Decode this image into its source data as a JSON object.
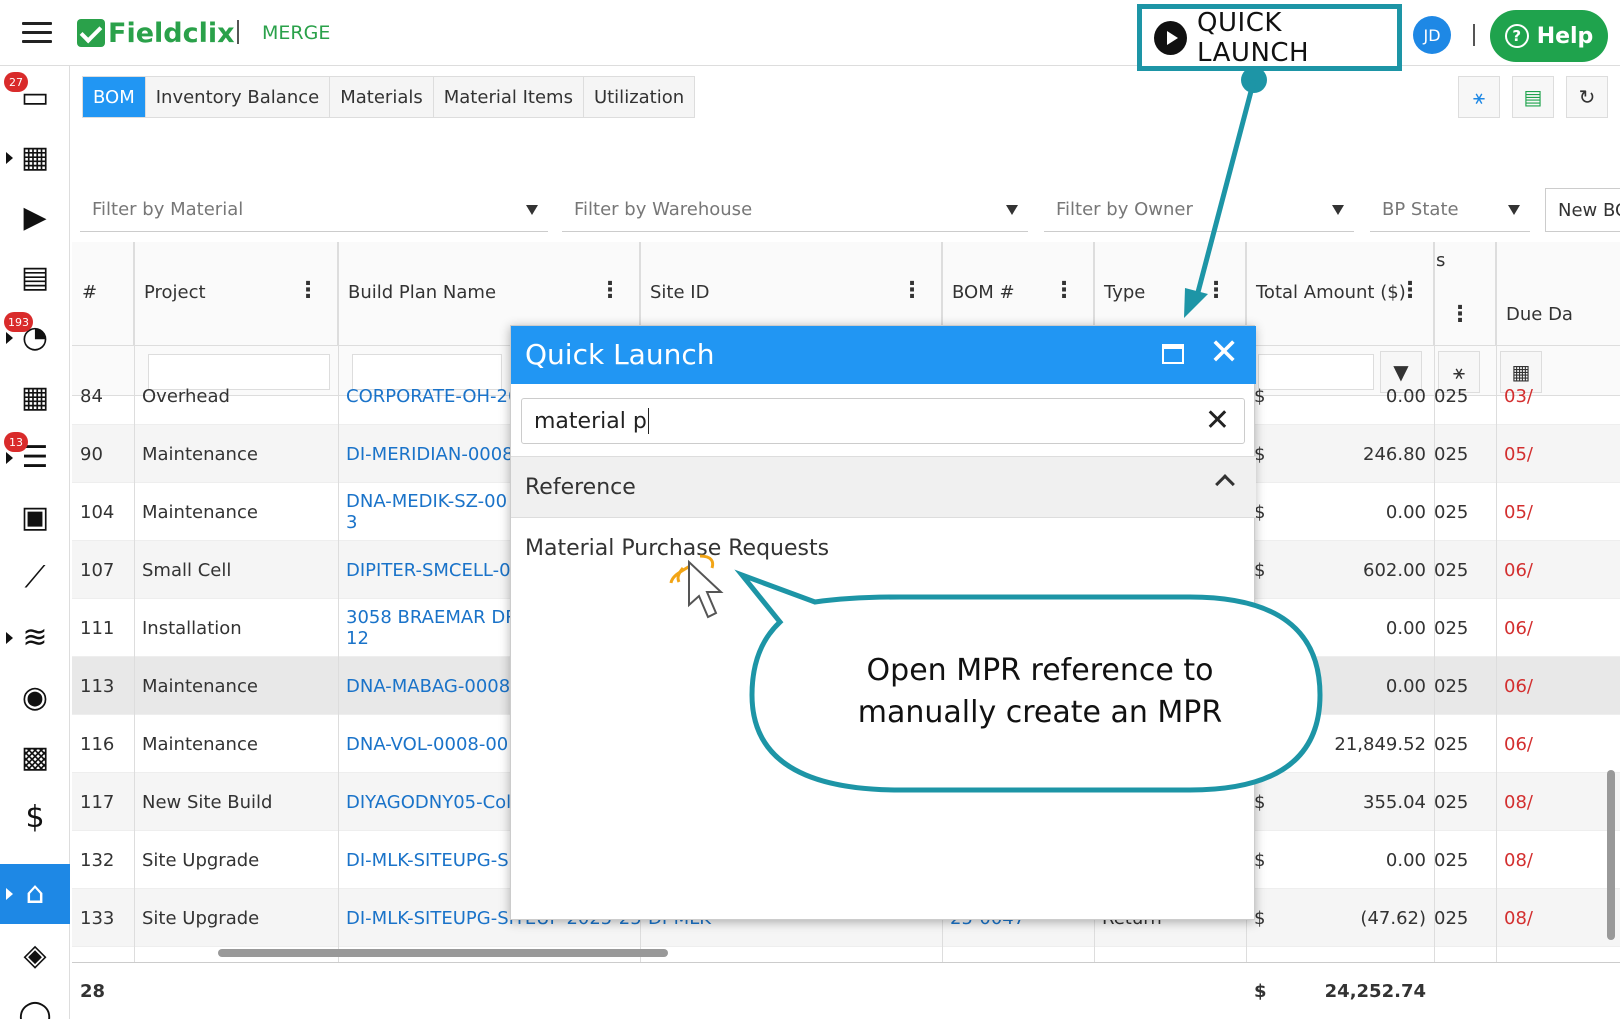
{
  "header": {
    "brand": "Fieldclix",
    "brand_sub": "MERGE",
    "quick_launch": "QUICK LAUNCH",
    "avatar": "JD",
    "help": "Help"
  },
  "sidebar": {
    "badges": [
      "27",
      "193",
      "13"
    ]
  },
  "tabs": [
    "BOM",
    "Inventory Balance",
    "Materials",
    "Material Items",
    "Utilization"
  ],
  "filters": {
    "material": "Filter by Material",
    "warehouse": "Filter by Warehouse",
    "owner": "Filter by Owner",
    "bp_state": "BP State",
    "new_button": "New BC"
  },
  "columns": [
    "#",
    "Project",
    "Build Plan Name",
    "Site ID",
    "BOM #",
    "Type",
    "Total Amount ($)",
    "s",
    "Due Da"
  ],
  "rows": [
    {
      "num": "84",
      "project": "Overhead",
      "plan": "CORPORATE-OH-20",
      "plan2": "",
      "site": "",
      "bom": "",
      "type": "",
      "cur": "$",
      "amount": "0.00",
      "year": "025",
      "due": "03/"
    },
    {
      "num": "90",
      "project": "Maintenance",
      "plan": "DI-MERIDIAN-0008",
      "plan2": "",
      "site": "",
      "bom": "",
      "type": "",
      "cur": "$",
      "amount": "246.80",
      "year": "025",
      "due": "05/"
    },
    {
      "num": "104",
      "project": "Maintenance",
      "plan": "DNA-MEDIK-SZ-00",
      "plan2": "3",
      "site": "",
      "bom": "",
      "type": "",
      "cur": "$",
      "amount": "0.00",
      "year": "025",
      "due": "05/"
    },
    {
      "num": "107",
      "project": "Small Cell",
      "plan": "DIPITER-SMCELL-0",
      "plan2": "",
      "site": "",
      "bom": "",
      "type": "",
      "cur": "$",
      "amount": "602.00",
      "year": "025",
      "due": "06/"
    },
    {
      "num": "111",
      "project": "Installation",
      "plan": "3058 BRAEMAR DR",
      "plan2": "12",
      "site": "",
      "bom": "",
      "type": "",
      "cur": "",
      "amount": "0.00",
      "year": "025",
      "due": "06/"
    },
    {
      "num": "113",
      "project": "Maintenance",
      "plan": "DNA-MABAG-0008",
      "plan2": "",
      "site": "",
      "bom": "",
      "type": "",
      "cur": "",
      "amount": "0.00",
      "year": "025",
      "due": "06/"
    },
    {
      "num": "116",
      "project": "Maintenance",
      "plan": "DNA-VOL-0008-00",
      "plan2": "",
      "site": "",
      "bom": "",
      "type": "",
      "cur": "$",
      "amount": "21,849.52",
      "year": "025",
      "due": "06/"
    },
    {
      "num": "117",
      "project": "New Site Build",
      "plan": "DIYAGODNY05-Col",
      "plan2": "",
      "site": "",
      "bom": "",
      "type": "",
      "cur": "$",
      "amount": "355.04",
      "year": "025",
      "due": "08/"
    },
    {
      "num": "132",
      "project": "Site Upgrade",
      "plan": "DI-MLK-SITEUPG-S",
      "plan2": "",
      "site": "",
      "bom": "",
      "type": "",
      "cur": "$",
      "amount": "0.00",
      "year": "025",
      "due": "08/"
    },
    {
      "num": "133",
      "project": "Site Upgrade",
      "plan": "DI-MLK-SITEUPG-SITEUP-2025-25",
      "plan2": "",
      "site": "DI-MLK",
      "bom": "25-0047",
      "type": "Return",
      "cur": "$",
      "amount": "(47.62)",
      "year": "025",
      "due": "08/"
    }
  ],
  "footer": {
    "count": "28",
    "cur": "$",
    "total": "24,252.74"
  },
  "quick_launch_dialog": {
    "title": "Quick Launch",
    "search_value": "material p",
    "section": "Reference",
    "item": "Material Purchase Requests"
  },
  "callout": {
    "line1": "Open MPR reference to",
    "line2": "manually create an MPR"
  },
  "colors": {
    "brand_green": "#2aa14a",
    "primary_blue": "#2196f3",
    "callout_teal": "#1d95a6",
    "link_blue": "#1a73c9",
    "due_red": "#d32f2f"
  }
}
